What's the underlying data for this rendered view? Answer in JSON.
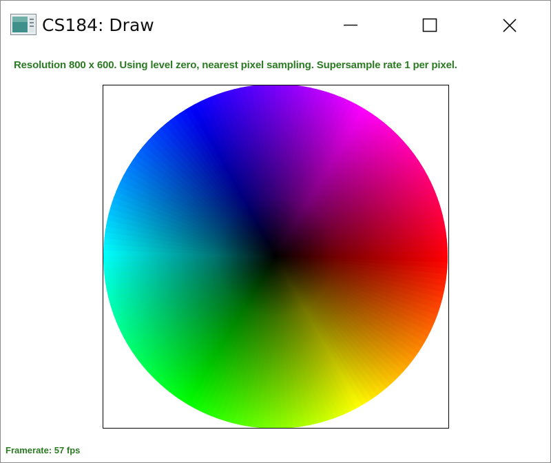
{
  "window": {
    "title": "CS184: Draw",
    "icon": "app-window-icon",
    "controls": {
      "minimize_icon": "minimize-icon",
      "maximize_icon": "maximize-icon",
      "close_icon": "close-icon"
    }
  },
  "status": {
    "info": "Resolution 800 x 600. Using level zero, nearest pixel sampling. Supersample rate 1 per pixel.",
    "framerate": "Framerate: 57 fps"
  },
  "canvas": {
    "content": "color-wheel",
    "hue_colors": [
      "#ff0000",
      "#ffff00",
      "#00ff00",
      "#00ffff",
      "#0000ff",
      "#ff00ff"
    ],
    "center_color": "#000000"
  },
  "colors": {
    "status_text": "#2a7a22",
    "frame_border": "#000000"
  }
}
